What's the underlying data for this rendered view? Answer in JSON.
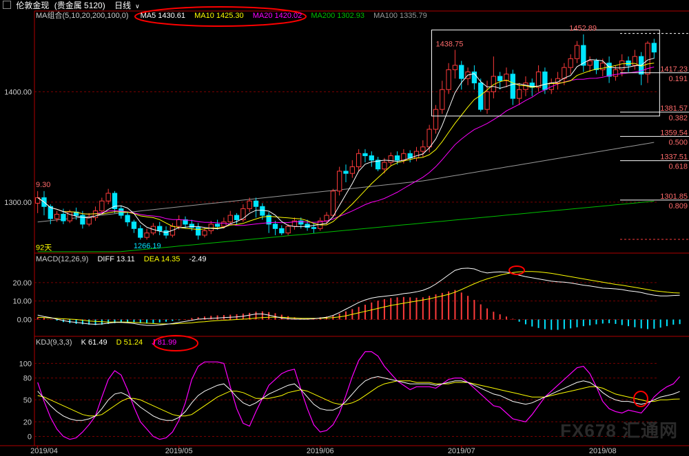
{
  "header": {
    "instrument": "伦敦金现",
    "category": "(贵金属 5120)",
    "period": "日线"
  },
  "ma_legend": {
    "label": "MA组合(5,10,20,200,100,0)",
    "ma5": "MA5 1430.61",
    "ma10": "MA10 1425.30",
    "ma20": "MA20 1420.02",
    "ma200": "MA200 1302.93",
    "ma100": "MA100 1335.79"
  },
  "macd_legend": {
    "label": "MACD(12,26,9)",
    "diff": "DIFF 13.11",
    "dea": "DEA 14.35",
    "macd": "-2.49"
  },
  "kdj_legend": {
    "label": "KDJ(9,3,3)",
    "k": "K 61.49",
    "d": "D 51.24",
    "j": "J 81.99"
  },
  "annotations": {
    "high": "1452.89",
    "local_high": "1438.75",
    "low": "1266.19",
    "left_price": "9.30",
    "left_days": "92天"
  },
  "fib_levels": [
    {
      "price": "1417.23",
      "ratio": "0.191",
      "value": 1417.23
    },
    {
      "price": "1381.57",
      "ratio": "0.382",
      "value": 1381.57
    },
    {
      "price": "1359.54",
      "ratio": "0.500",
      "value": 1359.54
    },
    {
      "price": "1337.51",
      "ratio": "0.618",
      "value": 1337.51
    },
    {
      "price": "1301.85",
      "ratio": "0.809",
      "value": 1301.85
    }
  ],
  "colors": {
    "up": "#ff3b3b",
    "down": "#00e5ff",
    "ma5": "#ffffff",
    "ma10": "#ffff00",
    "ma20": "#ff00ff",
    "ma200": "#00c000",
    "ma100": "#9a9a9a",
    "grid": "#7a0000",
    "axis": "#b00000",
    "highlight": "#ff0000"
  },
  "watermark": "FX678 汇通网",
  "chart_data": [
    {
      "type": "candlestick",
      "ylim": [
        1255,
        1462
      ],
      "yticks": [
        1300,
        1400
      ],
      "ytick_labels": [
        "1300.00",
        "1400.00"
      ],
      "x_tick_labels": [
        "2019/04",
        "2019/05",
        "2019/06",
        "2019/07",
        "2019/08"
      ],
      "x_tick_index": [
        0,
        22,
        44,
        66,
        88
      ],
      "candles": [
        [
          1299,
          1304,
          1290,
          1310
        ],
        [
          1304,
          1296,
          1288,
          1310
        ],
        [
          1296,
          1285,
          1280,
          1298
        ],
        [
          1285,
          1289,
          1282,
          1292
        ],
        [
          1289,
          1283,
          1280,
          1294
        ],
        [
          1283,
          1291,
          1281,
          1293
        ],
        [
          1291,
          1288,
          1284,
          1295
        ],
        [
          1288,
          1280,
          1276,
          1292
        ],
        [
          1280,
          1286,
          1278,
          1290
        ],
        [
          1286,
          1292,
          1283,
          1296
        ],
        [
          1292,
          1301,
          1289,
          1304
        ],
        [
          1301,
          1308,
          1298,
          1312
        ],
        [
          1308,
          1294,
          1290,
          1310
        ],
        [
          1294,
          1288,
          1285,
          1297
        ],
        [
          1288,
          1282,
          1278,
          1291
        ],
        [
          1282,
          1276,
          1272,
          1284
        ],
        [
          1276,
          1268,
          1266,
          1279
        ],
        [
          1268,
          1272,
          1266,
          1276
        ],
        [
          1272,
          1278,
          1270,
          1281
        ],
        [
          1278,
          1274,
          1270,
          1282
        ],
        [
          1274,
          1270,
          1267,
          1278
        ],
        [
          1270,
          1278,
          1268,
          1281
        ],
        [
          1278,
          1284,
          1275,
          1288
        ],
        [
          1284,
          1280,
          1276,
          1287
        ],
        [
          1280,
          1277,
          1274,
          1284
        ],
        [
          1277,
          1270,
          1266,
          1281
        ],
        [
          1270,
          1274,
          1268,
          1277
        ],
        [
          1274,
          1280,
          1271,
          1283
        ],
        [
          1280,
          1278,
          1275,
          1284
        ],
        [
          1278,
          1282,
          1276,
          1286
        ],
        [
          1282,
          1288,
          1280,
          1292
        ],
        [
          1288,
          1284,
          1280,
          1290
        ],
        [
          1284,
          1294,
          1282,
          1298
        ],
        [
          1294,
          1301,
          1291,
          1304
        ],
        [
          1301,
          1296,
          1286,
          1304
        ],
        [
          1296,
          1288,
          1284,
          1299
        ],
        [
          1288,
          1280,
          1272,
          1291
        ],
        [
          1280,
          1276,
          1270,
          1283
        ],
        [
          1276,
          1272,
          1270,
          1279
        ],
        [
          1272,
          1278,
          1270,
          1280
        ],
        [
          1278,
          1283,
          1275,
          1286
        ],
        [
          1283,
          1280,
          1276,
          1286
        ],
        [
          1280,
          1277,
          1274,
          1284
        ],
        [
          1277,
          1276,
          1272,
          1281
        ],
        [
          1276,
          1283,
          1274,
          1286
        ],
        [
          1283,
          1288,
          1280,
          1291
        ],
        [
          1288,
          1310,
          1286,
          1312
        ],
        [
          1310,
          1328,
          1306,
          1332
        ],
        [
          1328,
          1326,
          1318,
          1334
        ],
        [
          1326,
          1332,
          1322,
          1338
        ],
        [
          1332,
          1344,
          1328,
          1348
        ],
        [
          1344,
          1342,
          1336,
          1348
        ],
        [
          1342,
          1338,
          1332,
          1346
        ],
        [
          1338,
          1330,
          1328,
          1341
        ],
        [
          1330,
          1336,
          1326,
          1340
        ],
        [
          1336,
          1342,
          1333,
          1345
        ],
        [
          1342,
          1338,
          1334,
          1346
        ],
        [
          1338,
          1344,
          1335,
          1348
        ],
        [
          1344,
          1340,
          1336,
          1347
        ],
        [
          1340,
          1346,
          1337,
          1350
        ],
        [
          1346,
          1350,
          1341,
          1356
        ],
        [
          1350,
          1366,
          1345,
          1370
        ],
        [
          1366,
          1384,
          1362,
          1388
        ],
        [
          1384,
          1402,
          1380,
          1410
        ],
        [
          1402,
          1420,
          1398,
          1426
        ],
        [
          1420,
          1424,
          1412,
          1438
        ],
        [
          1424,
          1412,
          1402,
          1428
        ],
        [
          1412,
          1418,
          1406,
          1422
        ],
        [
          1418,
          1408,
          1402,
          1424
        ],
        [
          1408,
          1384,
          1382,
          1412
        ],
        [
          1384,
          1400,
          1380,
          1410
        ],
        [
          1400,
          1414,
          1394,
          1432
        ],
        [
          1414,
          1410,
          1402,
          1418
        ],
        [
          1410,
          1416,
          1404,
          1422
        ],
        [
          1416,
          1394,
          1388,
          1420
        ],
        [
          1394,
          1402,
          1388,
          1408
        ],
        [
          1402,
          1408,
          1396,
          1414
        ],
        [
          1408,
          1404,
          1396,
          1412
        ],
        [
          1404,
          1418,
          1400,
          1424
        ],
        [
          1418,
          1402,
          1398,
          1422
        ],
        [
          1402,
          1408,
          1398,
          1412
        ],
        [
          1408,
          1412,
          1402,
          1418
        ],
        [
          1412,
          1422,
          1406,
          1426
        ],
        [
          1422,
          1430,
          1416,
          1434
        ],
        [
          1430,
          1442,
          1426,
          1446
        ],
        [
          1442,
          1424,
          1418,
          1452
        ],
        [
          1424,
          1428,
          1418,
          1432
        ],
        [
          1428,
          1420,
          1416,
          1430
        ],
        [
          1420,
          1426,
          1414,
          1430
        ],
        [
          1426,
          1414,
          1408,
          1432
        ],
        [
          1414,
          1420,
          1410,
          1424
        ],
        [
          1420,
          1428,
          1414,
          1434
        ],
        [
          1428,
          1424,
          1418,
          1432
        ],
        [
          1424,
          1432,
          1420,
          1438
        ],
        [
          1432,
          1416,
          1406,
          1436
        ],
        [
          1416,
          1444,
          1408,
          1446
        ],
        [
          1444,
          1436,
          1430,
          1448
        ]
      ]
    },
    {
      "type": "line+bar",
      "name": "MACD",
      "ylim": [
        -8,
        30
      ],
      "yticks": [
        0,
        10,
        20
      ],
      "ytick_labels": [
        "0.00",
        "10.00",
        "20.00"
      ],
      "macd_hist": [
        1.2,
        0.8,
        0.2,
        -0.6,
        -1.4,
        -2.0,
        -2.4,
        -2.6,
        -2.8,
        -3.0,
        -2.8,
        -2.4,
        -2.0,
        -1.8,
        -1.6,
        -1.8,
        -2.0,
        -2.2,
        -2.0,
        -1.6,
        -1.2,
        -0.8,
        -0.4,
        0.2,
        0.8,
        1.2,
        1.6,
        2.0,
        2.2,
        2.4,
        2.6,
        2.8,
        3.2,
        3.6,
        4.2,
        4.4,
        4.0,
        3.4,
        2.6,
        1.8,
        1.2,
        0.8,
        0.6,
        0.8,
        1.2,
        1.6,
        2.2,
        3.2,
        4.4,
        5.6,
        6.8,
        8.0,
        9.2,
        10.2,
        11.0,
        11.6,
        12.0,
        12.2,
        12.0,
        11.8,
        12.0,
        12.8,
        13.6,
        14.4,
        15.2,
        16.0,
        14.6,
        12.8,
        10.6,
        8.2,
        6.0,
        4.2,
        2.8,
        1.6,
        0.4,
        -1.2,
        -2.6,
        -3.8,
        -4.6,
        -5.2,
        -5.6,
        -5.6,
        -5.2,
        -4.8,
        -4.2,
        -3.6,
        -3.2,
        -2.6,
        -2.2,
        -2.0,
        -2.4,
        -3.0,
        -3.6,
        -4.2,
        -4.8,
        -5.2,
        -5.0,
        -4.4,
        -3.6,
        -2.8,
        -2.5
      ],
      "diff": [
        2.4,
        1.6,
        1.0,
        0.2,
        -0.6,
        -1.2,
        -1.6,
        -2.0,
        -2.4,
        -2.6,
        -2.4,
        -2.0,
        -1.6,
        -1.6,
        -1.8,
        -2.2,
        -2.8,
        -3.2,
        -3.2,
        -3.0,
        -2.6,
        -2.2,
        -1.6,
        -1.0,
        -0.4,
        0.2,
        0.4,
        0.6,
        0.8,
        1.0,
        1.2,
        1.4,
        1.8,
        2.4,
        3.0,
        3.0,
        2.4,
        1.6,
        0.8,
        0.4,
        0.2,
        0.2,
        0.2,
        0.4,
        0.8,
        1.2,
        2.2,
        3.8,
        5.6,
        7.4,
        9.2,
        10.6,
        11.6,
        12.2,
        12.6,
        13.0,
        13.4,
        14.0,
        14.4,
        15.0,
        15.8,
        17.2,
        19.2,
        21.6,
        24.2,
        26.6,
        27.6,
        27.8,
        27.4,
        26.0,
        25.2,
        25.6,
        25.8,
        25.6,
        25.0,
        24.0,
        23.2,
        22.6,
        22.0,
        21.4,
        20.8,
        20.4,
        20.2,
        19.8,
        19.2,
        18.6,
        18.2,
        17.6,
        17.0,
        16.8,
        16.6,
        16.2,
        15.6,
        15.2,
        14.6,
        13.8,
        13.2,
        12.8,
        12.8,
        13.0,
        13.11
      ],
      "dea": [
        1.2,
        1.0,
        0.8,
        0.6,
        0.4,
        0.2,
        0.0,
        -0.4,
        -0.8,
        -1.0,
        -1.2,
        -1.4,
        -1.4,
        -1.4,
        -1.4,
        -1.6,
        -1.8,
        -2.0,
        -2.2,
        -2.4,
        -2.4,
        -2.4,
        -2.2,
        -2.0,
        -1.8,
        -1.4,
        -1.2,
        -0.8,
        -0.6,
        -0.4,
        -0.2,
        0.0,
        0.2,
        0.4,
        0.8,
        1.0,
        1.2,
        1.2,
        1.2,
        1.0,
        0.8,
        0.6,
        0.6,
        0.6,
        0.6,
        0.8,
        1.0,
        1.4,
        2.0,
        2.8,
        3.6,
        4.4,
        5.2,
        6.0,
        6.8,
        7.6,
        8.2,
        8.8,
        9.4,
        10.0,
        10.6,
        11.2,
        12.0,
        12.8,
        13.6,
        14.8,
        16.2,
        17.8,
        19.4,
        20.8,
        22.0,
        23.0,
        24.0,
        24.8,
        25.4,
        25.8,
        26.0,
        26.0,
        25.8,
        25.4,
        25.0,
        24.4,
        23.8,
        23.2,
        22.6,
        22.0,
        21.4,
        20.8,
        20.2,
        19.6,
        19.0,
        18.6,
        18.0,
        17.4,
        16.8,
        16.2,
        15.6,
        15.2,
        14.8,
        14.5,
        14.35
      ]
    },
    {
      "type": "line",
      "name": "KDJ",
      "ylim": [
        -8,
        122
      ],
      "yticks": [
        0,
        20,
        50,
        80,
        100
      ],
      "ytick_labels": [
        "0",
        "20",
        "50",
        "80",
        "100"
      ],
      "k": [
        62,
        52,
        42,
        34,
        28,
        24,
        22,
        22,
        24,
        28,
        38,
        50,
        58,
        60,
        56,
        48,
        40,
        34,
        28,
        24,
        22,
        22,
        26,
        34,
        46,
        56,
        62,
        66,
        70,
        72,
        64,
        54,
        46,
        42,
        46,
        52,
        58,
        62,
        66,
        70,
        72,
        64,
        54,
        44,
        38,
        36,
        36,
        40,
        48,
        58,
        68,
        76,
        80,
        82,
        80,
        78,
        76,
        74,
        72,
        72,
        72,
        72,
        70,
        72,
        74,
        76,
        76,
        74,
        70,
        66,
        62,
        58,
        56,
        52,
        48,
        46,
        44,
        46,
        50,
        54,
        58,
        62,
        66,
        70,
        74,
        76,
        74,
        68,
        60,
        54,
        50,
        48,
        48,
        46,
        44,
        46,
        50,
        54,
        56,
        58,
        61.49
      ],
      "d": [
        56,
        54,
        50,
        46,
        42,
        38,
        34,
        30,
        28,
        28,
        30,
        36,
        42,
        48,
        52,
        52,
        50,
        46,
        42,
        38,
        34,
        30,
        28,
        28,
        30,
        36,
        42,
        48,
        54,
        58,
        62,
        62,
        60,
        56,
        52,
        52,
        52,
        54,
        56,
        60,
        62,
        64,
        62,
        58,
        54,
        50,
        46,
        44,
        44,
        46,
        50,
        56,
        62,
        68,
        72,
        74,
        76,
        76,
        76,
        74,
        74,
        74,
        72,
        72,
        72,
        74,
        74,
        74,
        72,
        70,
        68,
        66,
        64,
        62,
        60,
        58,
        56,
        54,
        54,
        54,
        56,
        58,
        60,
        62,
        64,
        66,
        68,
        68,
        66,
        62,
        58,
        56,
        54,
        52,
        50,
        48,
        48,
        50,
        50,
        51,
        51.24
      ],
      "j": [
        74,
        48,
        26,
        10,
        0,
        -4,
        -2,
        6,
        16,
        28,
        54,
        78,
        90,
        84,
        64,
        40,
        20,
        10,
        0,
        -4,
        -2,
        6,
        22,
        46,
        78,
        96,
        102,
        102,
        102,
        100,
        68,
        38,
        18,
        14,
        34,
        52,
        70,
        78,
        86,
        90,
        92,
        64,
        38,
        16,
        6,
        8,
        16,
        32,
        56,
        82,
        104,
        116,
        116,
        110,
        96,
        86,
        76,
        70,
        64,
        68,
        68,
        68,
        66,
        72,
        78,
        80,
        80,
        74,
        66,
        58,
        50,
        42,
        40,
        32,
        24,
        22,
        20,
        30,
        42,
        54,
        62,
        70,
        78,
        86,
        94,
        96,
        86,
        68,
        48,
        38,
        34,
        32,
        36,
        34,
        32,
        42,
        54,
        62,
        68,
        72,
        81.99
      ]
    }
  ]
}
